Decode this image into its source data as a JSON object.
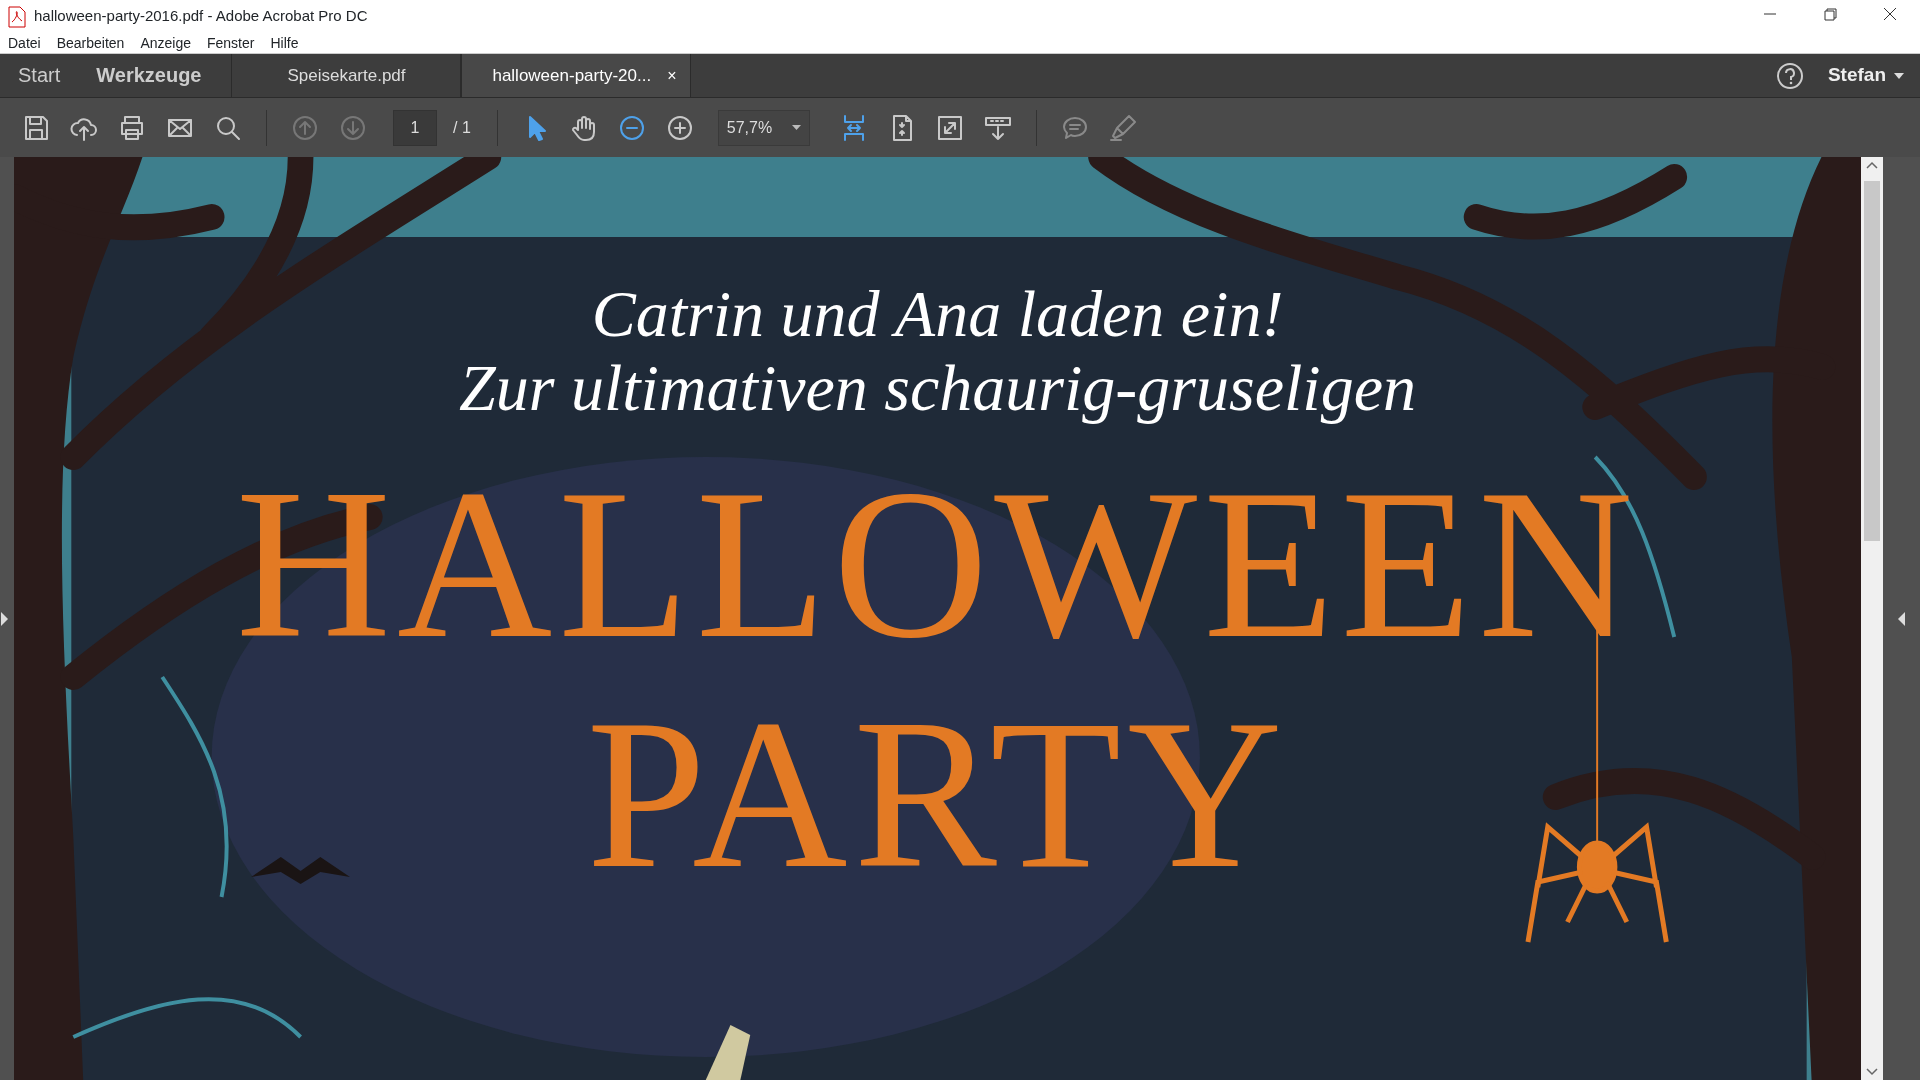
{
  "window": {
    "title": "halloween-party-2016.pdf - Adobe Acrobat Pro DC"
  },
  "menu": [
    "Datei",
    "Bearbeiten",
    "Anzeige",
    "Fenster",
    "Hilfe"
  ],
  "nav": [
    {
      "label": "Start"
    },
    {
      "label": "Werkzeuge"
    }
  ],
  "tabs": [
    {
      "label": "Speisekarte.pdf",
      "selected": false
    },
    {
      "label": "halloween-party-20...",
      "selected": true,
      "close": "×"
    }
  ],
  "user": {
    "name": "Stefan"
  },
  "toolbar": [
    {
      "kind": "save"
    },
    {
      "kind": "upload"
    },
    {
      "kind": "print"
    },
    {
      "kind": "mail"
    },
    {
      "kind": "search"
    },
    {
      "kind": "sep"
    },
    {
      "kind": "prev",
      "disabled": true
    },
    {
      "kind": "next",
      "disabled": true
    },
    {
      "kind": "page",
      "value": "1",
      "total": "/ 1"
    },
    {
      "kind": "sep"
    },
    {
      "kind": "select",
      "selected": true
    },
    {
      "kind": "hand",
      "selected": false
    },
    {
      "kind": "zoomout",
      "hovered": true
    },
    {
      "kind": "zoomin",
      "hovered": false
    },
    {
      "kind": "zoom",
      "value": "57,7%"
    },
    {
      "kind": "fitwidth",
      "on": true
    },
    {
      "kind": "fitpage",
      "on": false
    },
    {
      "kind": "fullscreen",
      "on": false
    },
    {
      "kind": "scrollmode",
      "on": false
    },
    {
      "kind": "sep"
    },
    {
      "kind": "comment"
    },
    {
      "kind": "highlight"
    }
  ],
  "document": {
    "lines": [
      "Catrin und Ana laden ein!",
      "Zur ultimativen schaurig-gruseligen"
    ],
    "title": [
      "HALLOWEEN",
      "PARTY"
    ]
  }
}
